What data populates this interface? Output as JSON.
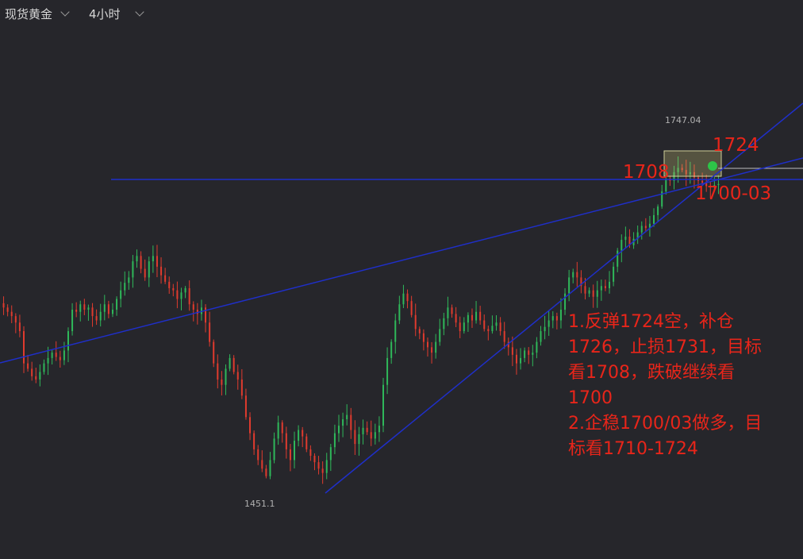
{
  "toolbar": {
    "symbol": "现货黄金",
    "timeframe": "4小时"
  },
  "colors": {
    "background": "#26262b",
    "up": "#2fb85a",
    "down": "#e03b2e",
    "trendline": "#1f2fc9",
    "annotation": "#e8251a"
  },
  "chart_data": {
    "type": "candlestick",
    "ylim": [
      1440,
      1780
    ],
    "high_label": "1747.04",
    "low_label": "1451.1",
    "levels": [
      "1724",
      "1708",
      "1700-03"
    ],
    "closes": [
      1612,
      1608,
      1604,
      1598,
      1590,
      1560,
      1555,
      1548,
      1545,
      1552,
      1560,
      1565,
      1570,
      1566,
      1563,
      1572,
      1590,
      1610,
      1608,
      1615,
      1610,
      1612,
      1604,
      1600,
      1608,
      1615,
      1606,
      1610,
      1620,
      1628,
      1635,
      1640,
      1655,
      1660,
      1648,
      1640,
      1655,
      1660,
      1650,
      1642,
      1636,
      1630,
      1628,
      1620,
      1626,
      1630,
      1615,
      1610,
      1606,
      1612,
      1598,
      1580,
      1560,
      1545,
      1540,
      1555,
      1565,
      1552,
      1545,
      1530,
      1510,
      1495,
      1480,
      1470,
      1462,
      1455,
      1470,
      1490,
      1505,
      1495,
      1480,
      1470,
      1488,
      1498,
      1492,
      1480,
      1474,
      1468,
      1462,
      1458,
      1470,
      1482,
      1495,
      1502,
      1508,
      1512,
      1498,
      1485,
      1494,
      1500,
      1496,
      1490,
      1496,
      1502,
      1540,
      1565,
      1580,
      1600,
      1615,
      1625,
      1618,
      1605,
      1592,
      1588,
      1580,
      1575,
      1570,
      1580,
      1592,
      1602,
      1612,
      1606,
      1598,
      1590,
      1598,
      1605,
      1600,
      1608,
      1600,
      1592,
      1590,
      1595,
      1598,
      1590,
      1580,
      1575,
      1568,
      1560,
      1565,
      1572,
      1568,
      1570,
      1580,
      1590,
      1594,
      1600,
      1604,
      1600,
      1610,
      1625,
      1640,
      1645,
      1640,
      1632,
      1625,
      1628,
      1622,
      1628,
      1632,
      1630,
      1636,
      1650,
      1665,
      1675,
      1678,
      1670,
      1676,
      1682,
      1688,
      1686,
      1690,
      1698,
      1706,
      1720,
      1732,
      1730,
      1738,
      1742,
      1740,
      1736,
      1738,
      1733,
      1730,
      1728,
      1725,
      1724,
      1726,
      1727
    ]
  },
  "plan": {
    "line1": "1.反弹1724空，补仓",
    "line2": "1726，止损1731，目标",
    "line3": "看1708，跌破继续看",
    "line4": "1700",
    "line5": "2.企稳1700/03做多，目",
    "line6": "标看1710-1724"
  }
}
